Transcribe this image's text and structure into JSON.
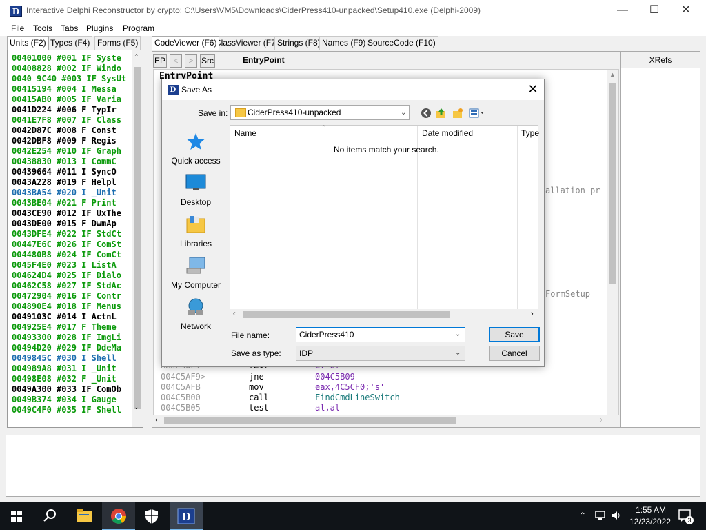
{
  "window": {
    "title": "Interactive Delphi Reconstructor by crypto: C:\\Users\\VM5\\Downloads\\CiderPress410-unpacked\\Setup410.exe (Delphi-2009)",
    "icon_letter": "D"
  },
  "menu": [
    "File",
    "Tools",
    "Tabs",
    "Plugins",
    "Program"
  ],
  "left_tabs": [
    "Units (F2)",
    "Types (F4)",
    "Forms (F5)"
  ],
  "units": [
    {
      "text": "00401000 #001 IF Syste",
      "color": "#0a9a0a"
    },
    {
      "text": "00408828 #002 IF Windo",
      "color": "#0a9a0a"
    },
    {
      "text": "0040 9C40 #003 IF SysUt",
      "color": "#0a9a0a"
    },
    {
      "text": "00415194 #004 I  Messa",
      "color": "#0a9a0a"
    },
    {
      "text": "00415AB0 #005 IF Varia",
      "color": "#0a9a0a"
    },
    {
      "text": "0041D224 #006  F TypIr",
      "color": "#000000"
    },
    {
      "text": "0041E7F8 #007 IF Class",
      "color": "#0a9a0a"
    },
    {
      "text": "0042D87C #008  F Const",
      "color": "#000000"
    },
    {
      "text": "0042DBF8 #009  F Regis",
      "color": "#000000"
    },
    {
      "text": "0042E254 #010 IF Graph",
      "color": "#0a9a0a"
    },
    {
      "text": "00438830 #013 I  CommC",
      "color": "#0a9a0a"
    },
    {
      "text": "00439664 #011 I  SyncO",
      "color": "#000000"
    },
    {
      "text": "0043A228 #019  F Helpl",
      "color": "#000000"
    },
    {
      "text": "0043BA54 #020 I  _Unit",
      "color": "#1e6fb0"
    },
    {
      "text": "0043BE04 #021  F Print",
      "color": "#0a9a0a"
    },
    {
      "text": "0043CE90 #012 IF UxThe",
      "color": "#000000"
    },
    {
      "text": "0043DE00 #015  F DwmAp",
      "color": "#000000"
    },
    {
      "text": "0043DFE4 #022 IF StdCt",
      "color": "#0a9a0a"
    },
    {
      "text": "00447E6C #026 IF ComSt",
      "color": "#0a9a0a"
    },
    {
      "text": "004480B8 #024 IF ComCt",
      "color": "#0a9a0a"
    },
    {
      "text": "0045F4E0 #023 I  ListA",
      "color": "#0a9a0a"
    },
    {
      "text": "004624D4 #025 IF Dialo",
      "color": "#0a9a0a"
    },
    {
      "text": "00462C58 #027 IF StdAc",
      "color": "#0a9a0a"
    },
    {
      "text": "00472904 #016 IF Contr",
      "color": "#0a9a0a"
    },
    {
      "text": "004890E4 #018 IF Menus",
      "color": "#0a9a0a"
    },
    {
      "text": "0049103C #014 I  ActnL",
      "color": "#000000"
    },
    {
      "text": "004925E4 #017  F Theme",
      "color": "#0a9a0a"
    },
    {
      "text": "00493300 #028 IF ImgLi",
      "color": "#0a9a0a"
    },
    {
      "text": "00494D20 #029 IF DdeMa",
      "color": "#0a9a0a"
    },
    {
      "text": "0049845C #030 I  Shell",
      "color": "#1e6fb0"
    },
    {
      "text": "004989A8 #031 I  _Unit",
      "color": "#0a9a0a"
    },
    {
      "text": "00498E08 #032  F _Unit",
      "color": "#0a9a0a"
    },
    {
      "text": "0049A300 #033 IF ComOb",
      "color": "#000000"
    },
    {
      "text": "0049B374 #034 I  Gauge",
      "color": "#0a9a0a"
    },
    {
      "text": "0049C4F0 #035 IF Shell",
      "color": "#0a9a0a"
    }
  ],
  "right_tabs": [
    "CodeViewer (F6)",
    "ClassViewer (F7)",
    "Strings (F8)",
    "Names (F9)",
    "SourceCode (F10)"
  ],
  "code_toolbar": {
    "ep": "EP",
    "back": "<",
    "fwd": ">",
    "src": "Src",
    "header": "EntryPoint"
  },
  "code": {
    "entry_label": "EntryPoint",
    "partial_1": "allation pr",
    "partial_2": "FormSetup",
    "lines": [
      {
        "addr": "004C5AF9>",
        "mn": "jne",
        "op": "004C5B09"
      },
      {
        "addr": "004C5AFB",
        "mn": "mov",
        "op": "eax,4C5CF0;'s'"
      },
      {
        "addr": "004C5B00",
        "mn": "call",
        "op": "FindCmdLineSwitch"
      },
      {
        "addr": "004C5B05",
        "mn": "test",
        "op": "al,al"
      }
    ],
    "partial_top": {
      "addr": "004C5AF7",
      "mn": "test",
      "op": "al,al"
    }
  },
  "xrefs_label": "XRefs",
  "dialog": {
    "title": "Save As",
    "save_in_label": "Save in:",
    "save_in_value": "CiderPress410-unpacked",
    "places": [
      "Quick access",
      "Desktop",
      "Libraries",
      "My Computer",
      "Network"
    ],
    "columns": [
      "Name",
      "Date modified",
      "Type"
    ],
    "empty_message": "No items match your search.",
    "file_name_label": "File name:",
    "file_name_value": "CiderPress410",
    "save_type_label": "Save as type:",
    "save_type_value": "IDP",
    "save_button": "Save",
    "cancel_button": "Cancel"
  },
  "taskbar": {
    "time": "1:55 AM",
    "date": "12/23/2022",
    "notification_count": "3"
  }
}
